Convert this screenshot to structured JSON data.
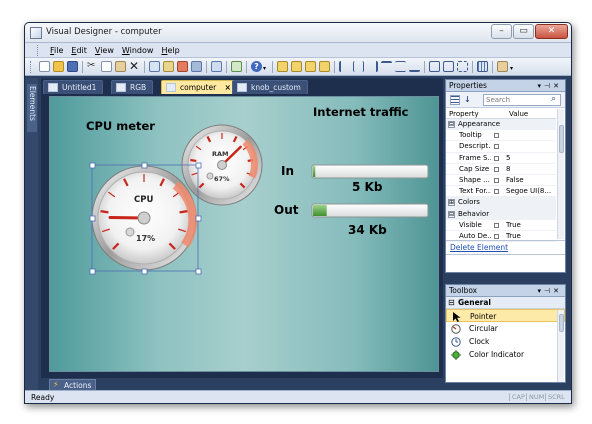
{
  "window": {
    "title": "Visual Designer - computer"
  },
  "menu": [
    "File",
    "Edit",
    "View",
    "Window",
    "Help"
  ],
  "side_tab": {
    "label": "Elements"
  },
  "doc_tabs": [
    {
      "label": "Untitled1",
      "active": false
    },
    {
      "label": "RGB",
      "active": false
    },
    {
      "label": "computer",
      "active": true,
      "close": "×"
    },
    {
      "label": "knob_custom",
      "active": false
    }
  ],
  "canvas": {
    "cpu_title": "CPU meter",
    "cpu_gauge": {
      "label": "CPU",
      "value_text": "17%",
      "value": 17
    },
    "ram_gauge": {
      "label": "RAM",
      "value_text": "67%",
      "value": 67
    },
    "traffic_title": "Internet traffic",
    "in": {
      "label": "In",
      "value_text": "5 Kb",
      "fill": 0.02
    },
    "out": {
      "label": "Out",
      "value_text": "34 Kb",
      "fill": 0.12
    }
  },
  "actions": {
    "label": "Actions"
  },
  "status": {
    "ready": "Ready",
    "indicators": [
      "CAP",
      "NUM",
      "SCRL"
    ]
  },
  "properties": {
    "title": "Properties",
    "search_placeholder": "Search",
    "columns": [
      "Property",
      "Value"
    ],
    "rows": [
      {
        "type": "cat",
        "name": "Appearance",
        "exp": "⊟"
      },
      {
        "type": "row",
        "name": "Tooltip",
        "value": ""
      },
      {
        "type": "row",
        "name": "Descript...",
        "value": ""
      },
      {
        "type": "row",
        "name": "Frame S...",
        "value": "5"
      },
      {
        "type": "row",
        "name": "Cap Size",
        "value": "8"
      },
      {
        "type": "row",
        "name": "Shape ...",
        "value": "False"
      },
      {
        "type": "row",
        "name": "Text For...",
        "value": "Segoe UI(8..."
      },
      {
        "type": "cat",
        "name": "Colors",
        "exp": "⊞"
      },
      {
        "type": "cat",
        "name": "Behavior",
        "exp": "⊟"
      },
      {
        "type": "row",
        "name": "Visible",
        "value": "True"
      },
      {
        "type": "row",
        "name": "Auto De...",
        "value": "True"
      }
    ],
    "delete_link": "Delete Element"
  },
  "toolbox": {
    "title": "Toolbox",
    "group": "General",
    "items": [
      {
        "label": "Pointer",
        "icon": "pointer-icon",
        "selected": true
      },
      {
        "label": "Circular",
        "icon": "circular-gauge-icon",
        "selected": false
      },
      {
        "label": "Clock",
        "icon": "clock-icon",
        "selected": false
      },
      {
        "label": "Color Indicator",
        "icon": "color-indicator-icon",
        "selected": false
      }
    ]
  },
  "colors": {
    "accent": "#ffe9a0",
    "frame": "#2b3f61",
    "canvas": "#8ec2c1",
    "gauge_red": "#c8261b"
  }
}
